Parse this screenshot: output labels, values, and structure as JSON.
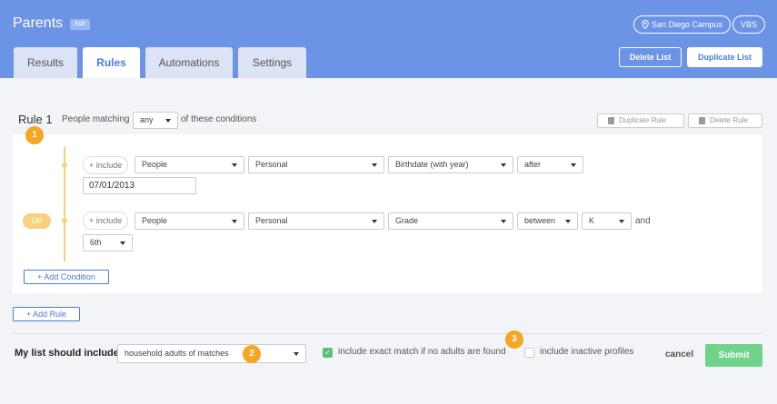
{
  "header": {
    "title": "Parents",
    "edit_label": "Edit",
    "campus_label": "San Diego Campus",
    "vbs_label": "VBS",
    "tabs": [
      {
        "label": "Results",
        "active": false
      },
      {
        "label": "Rules",
        "active": true
      },
      {
        "label": "Automations",
        "active": false
      },
      {
        "label": "Settings",
        "active": false
      }
    ],
    "delete_list_label": "Delete List",
    "duplicate_list_label": "Duplicate List",
    "accent_color": "#6b93e6"
  },
  "rule": {
    "title": "Rule 1",
    "people_matching_label": "People matching",
    "match_value": "any",
    "conditions_suffix": "of these conditions",
    "duplicate_rule_label": "Duplicate Rule",
    "delete_rule_label": "Delete Rule",
    "or_label": "OR",
    "conditions": [
      {
        "include_label": "+ include",
        "entity": "People",
        "category": "Personal",
        "field": "Birthdate (with year)",
        "operator": "after",
        "value": "07/01/2013"
      },
      {
        "include_label": "+ include",
        "entity": "People",
        "category": "Personal",
        "field": "Grade",
        "operator": "between",
        "value_from": "K",
        "and_label": "and",
        "value_to": "6th"
      }
    ],
    "add_condition_label": "Add Condition"
  },
  "add_rule_label": "Add Rule",
  "markers": [
    "1",
    "2",
    "3"
  ],
  "footer": {
    "include_label": "My list should include:",
    "include_value": "household adults of matches",
    "exact_match_label": "include exact match if no adults are found",
    "exact_match_checked": true,
    "inactive_label": "include inactive profiles",
    "inactive_checked": false,
    "cancel_label": "cancel",
    "submit_label": "Submit",
    "submit_color": "#6fd38b"
  }
}
